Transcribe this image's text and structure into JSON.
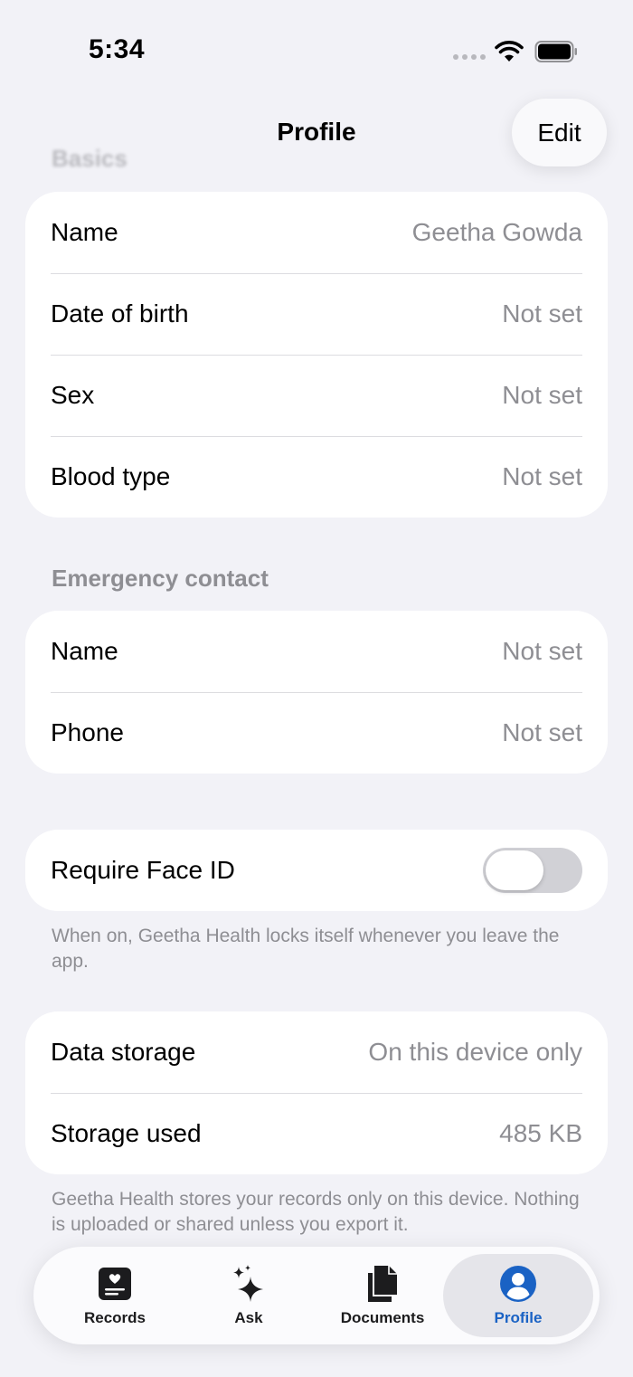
{
  "status_bar": {
    "time": "5:34"
  },
  "nav": {
    "title": "Profile",
    "edit_label": "Edit"
  },
  "basics": {
    "header": "Basics",
    "rows": [
      {
        "label": "Name",
        "value": "Geetha Gowda"
      },
      {
        "label": "Date of birth",
        "value": "Not set"
      },
      {
        "label": "Sex",
        "value": "Not set"
      },
      {
        "label": "Blood type",
        "value": "Not set"
      }
    ]
  },
  "emergency": {
    "header": "Emergency contact",
    "rows": [
      {
        "label": "Name",
        "value": "Not set"
      },
      {
        "label": "Phone",
        "value": "Not set"
      }
    ]
  },
  "security": {
    "face_id_label": "Require Face ID",
    "face_id_on": false,
    "footnote": "When on, Geetha Health locks itself whenever you leave the app."
  },
  "storage": {
    "rows": [
      {
        "label": "Data storage",
        "value": "On this device only"
      },
      {
        "label": "Storage used",
        "value": "485 KB"
      }
    ],
    "footnote": "Geetha Health stores your records only on this device. Nothing is uploaded or shared unless you export it."
  },
  "tabs": [
    {
      "label": "Records",
      "icon": "records-icon"
    },
    {
      "label": "Ask",
      "icon": "sparkle-icon"
    },
    {
      "label": "Documents",
      "icon": "documents-icon"
    },
    {
      "label": "Profile",
      "icon": "profile-icon",
      "active": true
    }
  ],
  "colors": {
    "accent": "#1a62c4",
    "background": "#f2f2f7",
    "secondary_text": "#8e8e93"
  }
}
